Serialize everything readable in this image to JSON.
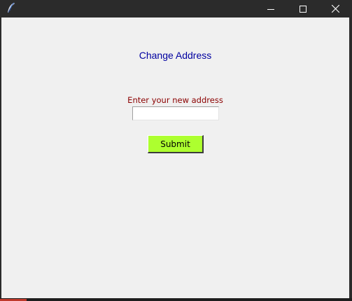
{
  "window": {
    "icon": "feather-icon",
    "controls": {
      "minimize_icon": "minimize-icon",
      "maximize_icon": "maximize-icon",
      "close_icon": "close-icon"
    }
  },
  "form": {
    "heading": "Change Address",
    "prompt_label": "Enter your new address",
    "address_value": "",
    "submit_label": "Submit"
  },
  "colors": {
    "titlebar": "#2b2b2b",
    "background": "#f0f0f0",
    "heading": "#0000a0",
    "prompt": "#8b0000",
    "submit_button": "#adff2f"
  }
}
